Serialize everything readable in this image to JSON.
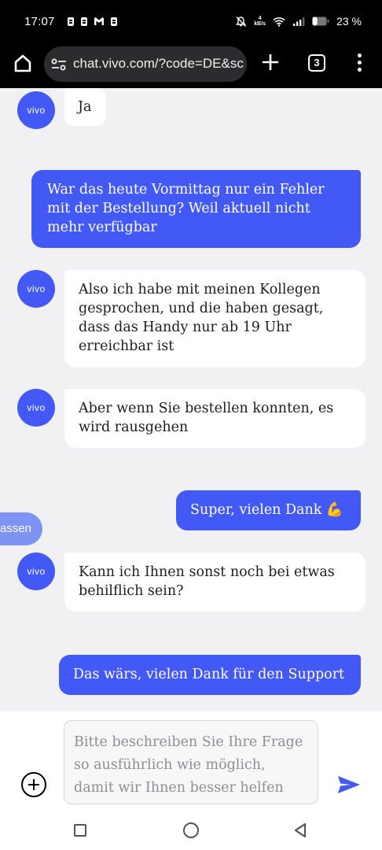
{
  "status_bar": {
    "time": "17:07",
    "net_speed_value": "4",
    "net_speed_unit": "kB/s",
    "battery": "23 %"
  },
  "browser": {
    "url": "chat.vivo.com/?code=DE&sc",
    "tab_count": "3"
  },
  "chat": {
    "avatar_label": "vivo",
    "floating_tab_label": "assen",
    "messages": [
      {
        "sender": "bot",
        "text": "Ja"
      },
      {
        "sender": "user",
        "text": "War das heute Vormittag nur ein Fehler mit der Bestellung? Weil aktuell nicht mehr verfügbar"
      },
      {
        "sender": "bot",
        "text": "Also ich habe mit meinen Kollegen gesprochen, und die haben gesagt, dass das Handy nur ab 19 Uhr erreichbar ist"
      },
      {
        "sender": "bot",
        "text": "Aber wenn Sie bestellen konnten, es wird rausgehen"
      },
      {
        "sender": "user",
        "text": "Super, vielen Dank 💪"
      },
      {
        "sender": "bot",
        "text": "Kann ich Ihnen sonst noch bei etwas behilflich sein?"
      },
      {
        "sender": "user",
        "text": "Das wärs, vielen Dank für den Support"
      }
    ]
  },
  "composer": {
    "placeholder": "Bitte beschreiben Sie Ihre Frage so ausführlich wie möglich, damit wir Ihnen besser helfen können"
  },
  "colors": {
    "accent": "#4359f5",
    "bot_bubble": "#ffffff",
    "chat_background": "#f1f1f3"
  }
}
